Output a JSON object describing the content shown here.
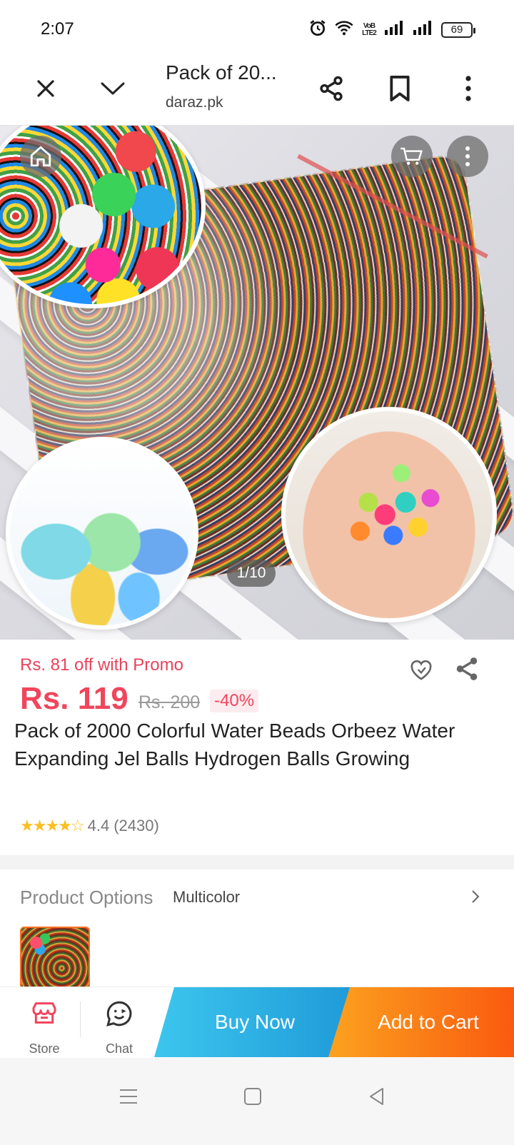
{
  "status_bar": {
    "time": "2:07",
    "network_label": "VoB LTE2",
    "battery": "69"
  },
  "browser": {
    "title": "Pack of 20...",
    "domain": "daraz.pk"
  },
  "gallery": {
    "counter": "1/10"
  },
  "product": {
    "promo_text": "Rs. 81 off with Promo",
    "price": "Rs. 119",
    "original_price": "Rs. 200",
    "discount": "-40%",
    "title": "Pack of 2000 Colorful Water Beads Orbeez Water Expanding Jel Balls Hydrogen Balls Growing",
    "rating": "4.4",
    "rating_count": "(2430)",
    "stars": "★★★★☆"
  },
  "options": {
    "label": "Product Options",
    "value": "Multicolor"
  },
  "bottom_bar": {
    "store_label": "Store",
    "chat_label": "Chat",
    "buy_now_label": "Buy Now",
    "add_to_cart_label": "Add to Cart"
  },
  "colors": {
    "price_red": "#f0455c",
    "buy_now_blue": "#1f9ad8",
    "add_to_cart_orange": "#fa5a0f"
  }
}
